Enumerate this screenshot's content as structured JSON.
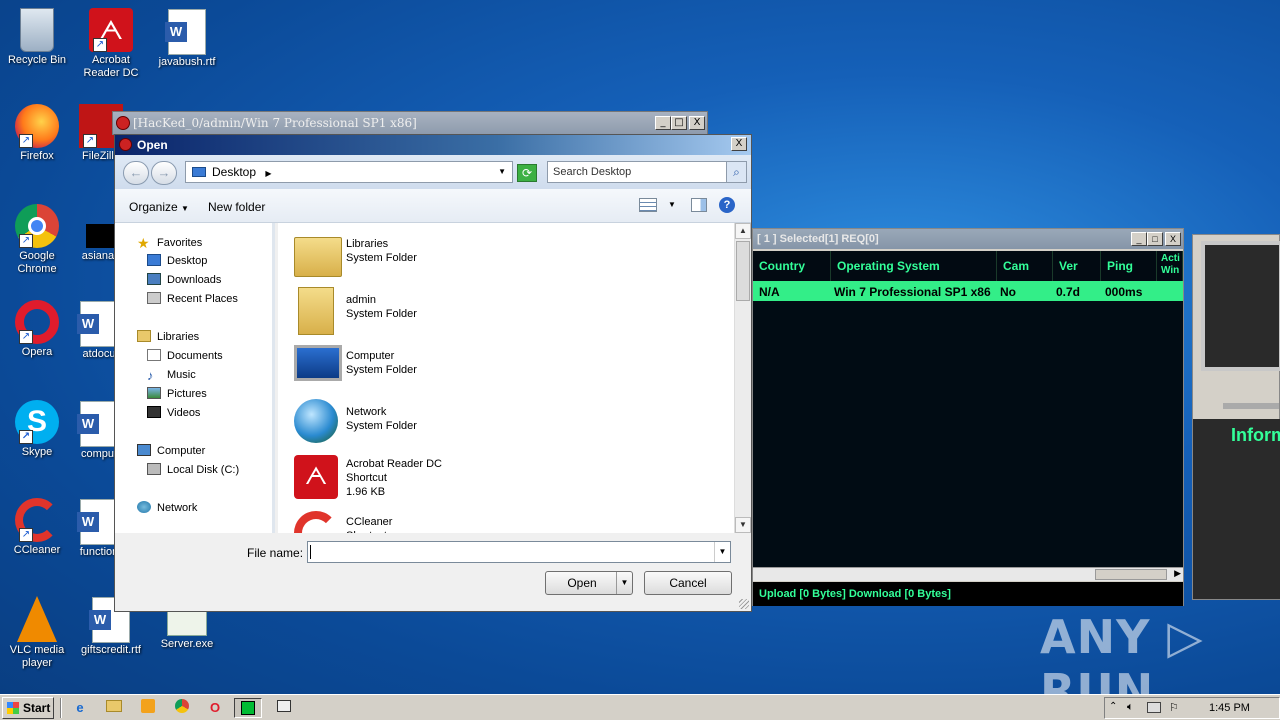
{
  "desktop": {
    "icons": [
      {
        "label": "Recycle Bin"
      },
      {
        "label": "Acrobat Reader DC"
      },
      {
        "label": "javabush.rtf"
      },
      {
        "label": "Firefox"
      },
      {
        "label": "FileZilla"
      },
      {
        "label": "Google Chrome"
      },
      {
        "label": "asianag"
      },
      {
        "label": "Opera"
      },
      {
        "label": "atdocu"
      },
      {
        "label": "Skype"
      },
      {
        "label": "comput"
      },
      {
        "label": "CCleaner"
      },
      {
        "label": "function"
      },
      {
        "label": "VLC media player"
      },
      {
        "label": "giftscredit.rtf"
      },
      {
        "label": "Server.exe"
      }
    ]
  },
  "rat_window": {
    "title": "[ 1 ]    Selected[1] REQ[0]",
    "columns": [
      "Country",
      "Operating System",
      "Cam",
      "Ver",
      "Ping",
      "Acti Win"
    ],
    "row": {
      "country": "N/A",
      "os": "Win 7 Professional SP1 x86",
      "cam": "No",
      "ver": "0.7d",
      "ping": "000ms"
    },
    "status": "Upload [0 Bytes]  Download [0 Bytes]",
    "info_label": "Inform",
    "min_glyph": "_",
    "max_glyph": "□",
    "close_glyph": "X"
  },
  "hacked_window": {
    "title": "[HacKed_0/admin/Win 7 Professional SP1 x86]",
    "min_glyph": "_",
    "max_glyph": "□",
    "close_glyph": "X"
  },
  "dialog": {
    "title": "Open",
    "close_glyph": "X",
    "back_glyph": "←",
    "forward_glyph": "→",
    "address": "Desktop",
    "refresh_glyph": "⟳",
    "search_placeholder": "Search Desktop",
    "search_glyph": "⌕",
    "organize_label": "Organize",
    "new_folder_label": "New folder",
    "help_glyph": "?",
    "nav": {
      "favorites": "Favorites",
      "desktop": "Desktop",
      "downloads": "Downloads",
      "recent": "Recent Places",
      "libraries": "Libraries",
      "documents": "Documents",
      "music": "Music",
      "pictures": "Pictures",
      "videos": "Videos",
      "computer": "Computer",
      "local_disk": "Local Disk (C:)",
      "network": "Network"
    },
    "files": [
      {
        "name": "Libraries",
        "type": "System Folder"
      },
      {
        "name": "admin",
        "type": "System Folder"
      },
      {
        "name": "Computer",
        "type": "System Folder"
      },
      {
        "name": "Network",
        "type": "System Folder"
      },
      {
        "name": "Acrobat Reader DC",
        "type": "Shortcut",
        "size": "1.96 KB"
      },
      {
        "name": "CCleaner",
        "type": "Shortcut"
      }
    ],
    "file_name_label": "File name:",
    "file_name_value": "",
    "open_label": "Open",
    "cancel_label": "Cancel"
  },
  "taskbar": {
    "start_label": "Start",
    "time": "1:45 PM"
  },
  "watermark": "ANY ▷ RUN"
}
